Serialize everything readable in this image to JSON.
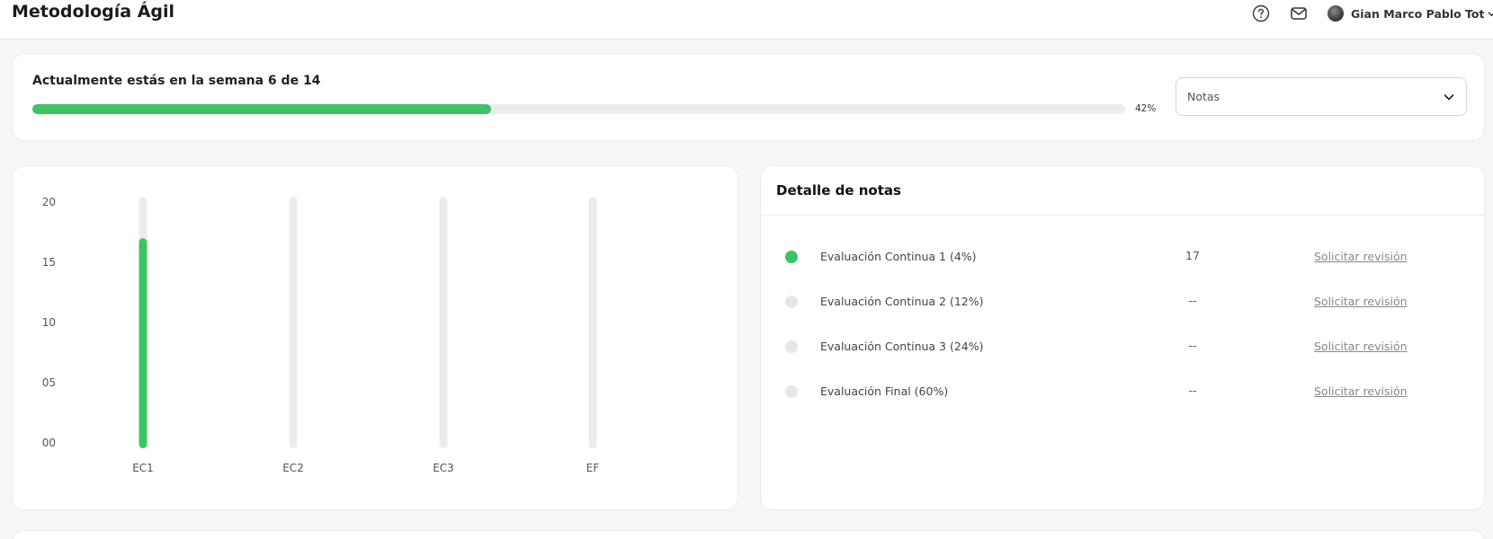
{
  "header": {
    "title": "Metodología Ágil",
    "user_name": "Gian Marco Pablo Tot",
    "icons": [
      "help-circle-icon",
      "mail-icon",
      "chevron-down-icon"
    ]
  },
  "progress": {
    "text": "Actualmente estás en la semana 6 de 14",
    "percent": 42,
    "percent_label": "42%",
    "select_value": "Notas"
  },
  "colors": {
    "accent": "#3cc463",
    "track": "#ececec",
    "inactive_dot": "#e6e6e6"
  },
  "chart_data": {
    "type": "bar",
    "categories": [
      "EC1",
      "EC2",
      "EC3",
      "EF"
    ],
    "values": [
      17,
      null,
      null,
      null
    ],
    "ylim": [
      0,
      20
    ],
    "yticks": [
      "00",
      "05",
      "10",
      "15",
      "20"
    ],
    "grid": false
  },
  "notes": {
    "title": "Detalle de notas",
    "items": [
      {
        "label": "Evaluación Continua 1 (4%)",
        "score": "17",
        "link": "Solicitar revisión",
        "active": true
      },
      {
        "label": "Evaluación Continua 2 (12%)",
        "score": "--",
        "link": "Solicitar revisión",
        "active": false
      },
      {
        "label": "Evaluación Continua 3 (24%)",
        "score": "--",
        "link": "Solicitar revisión",
        "active": false
      },
      {
        "label": "Evaluación Final (60%)",
        "score": "--",
        "link": "Solicitar revisión",
        "active": false
      }
    ]
  }
}
